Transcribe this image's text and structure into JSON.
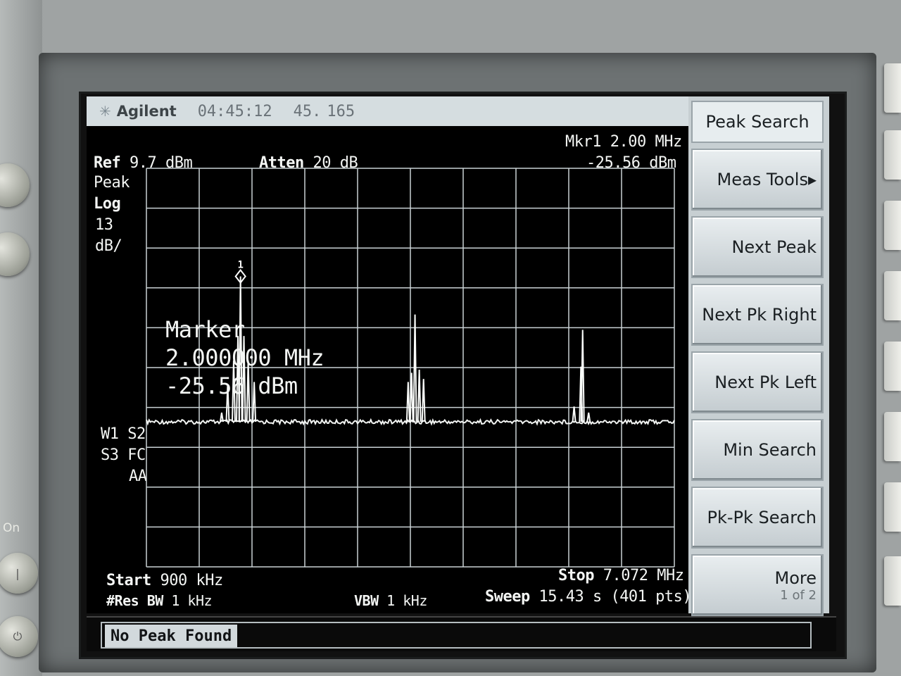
{
  "titlebar": {
    "brand": "Agilent",
    "time": "04:45:12",
    "date_a": "45.",
    "date_b": "165"
  },
  "header": {
    "ref_label": "Ref",
    "ref_value": "9.7 dBm",
    "atten_label": "Atten",
    "atten_value": "20 dB",
    "mkr_line1": "Mkr1  2.00 MHz",
    "mkr_line2": "-25.56 dBm"
  },
  "scale": {
    "mode": "Peak",
    "log": "Log",
    "per_div": "13",
    "unit": "dB/"
  },
  "trace_flags": {
    "line1": "W1  S2",
    "line2": "S3  FC",
    "line3": "AA"
  },
  "marker_readout": {
    "title": "Marker",
    "freq": "2.000000 MHz",
    "amp": "-25.56 dBm",
    "marker_number": "1"
  },
  "footer": {
    "start_label": "Start",
    "start_value": "900 kHz",
    "rbw_label": "#Res BW",
    "rbw_value": "1 kHz",
    "vbw_label": "VBW",
    "vbw_value": "1 kHz",
    "stop_label": "Stop",
    "stop_value": "7.072 MHz",
    "sweep_label": "Sweep",
    "sweep_value": "15.43 s (401 pts)"
  },
  "softkeys": {
    "title": "Peak Search",
    "items": [
      "Meas Tools▸",
      "Next Peak",
      "Next Pk Right",
      "Next Pk Left",
      "Min Search",
      "Pk-Pk Search"
    ],
    "more_label": "More",
    "more_page": "1 of 2"
  },
  "status": {
    "message": "No Peak Found"
  },
  "panel": {
    "on_label": "On"
  },
  "chart_data": {
    "type": "line",
    "xunit": "MHz",
    "yunit": "dBm",
    "xlim": [
      0.9,
      7.072
    ],
    "ylim": [
      -120.3,
      9.7
    ],
    "noise_floor": -73,
    "peaks": [
      {
        "x": 1.78,
        "y": -70
      },
      {
        "x": 1.85,
        "y": -61
      },
      {
        "x": 1.92,
        "y": -53
      },
      {
        "x": 1.97,
        "y": -45
      },
      {
        "x": 2.0,
        "y": -25.56
      },
      {
        "x": 2.04,
        "y": -45
      },
      {
        "x": 2.09,
        "y": -53
      },
      {
        "x": 2.16,
        "y": -60
      },
      {
        "x": 3.96,
        "y": -60
      },
      {
        "x": 4.0,
        "y": -57
      },
      {
        "x": 4.04,
        "y": -38
      },
      {
        "x": 4.09,
        "y": -56
      },
      {
        "x": 4.14,
        "y": -59
      },
      {
        "x": 5.9,
        "y": -68
      },
      {
        "x": 5.98,
        "y": -55
      },
      {
        "x": 6.0,
        "y": -43
      },
      {
        "x": 6.07,
        "y": -70
      }
    ]
  }
}
